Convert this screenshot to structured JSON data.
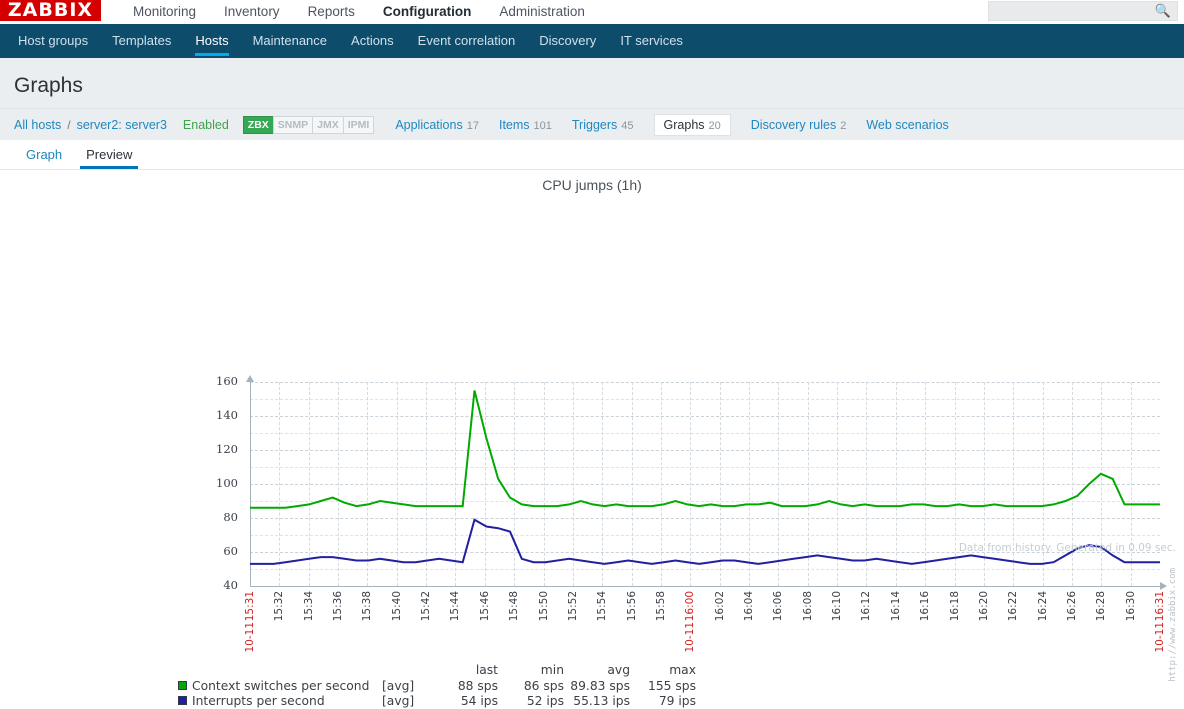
{
  "header": {
    "logo_text": "ZABBIX",
    "menu": [
      {
        "label": "Monitoring",
        "selected": false
      },
      {
        "label": "Inventory",
        "selected": false
      },
      {
        "label": "Reports",
        "selected": false
      },
      {
        "label": "Configuration",
        "selected": true
      },
      {
        "label": "Administration",
        "selected": false
      }
    ],
    "search": {
      "value": "",
      "placeholder": "",
      "icon": "search-icon"
    }
  },
  "submenu": [
    {
      "label": "Host groups",
      "selected": false
    },
    {
      "label": "Templates",
      "selected": false
    },
    {
      "label": "Hosts",
      "selected": true
    },
    {
      "label": "Maintenance",
      "selected": false
    },
    {
      "label": "Actions",
      "selected": false
    },
    {
      "label": "Event correlation",
      "selected": false
    },
    {
      "label": "Discovery",
      "selected": false
    },
    {
      "label": "IT services",
      "selected": false
    }
  ],
  "page": {
    "title": "Graphs"
  },
  "breadcrumb": {
    "all_hosts": "All hosts",
    "separator": "/",
    "host": "server2: server3",
    "status": "Enabled",
    "protocols": [
      {
        "label": "ZBX",
        "active": true
      },
      {
        "label": "SNMP",
        "active": false
      },
      {
        "label": "JMX",
        "active": false
      },
      {
        "label": "IPMI",
        "active": false
      }
    ],
    "links": [
      {
        "label": "Applications",
        "count": "17",
        "selected": false
      },
      {
        "label": "Items",
        "count": "101",
        "selected": false
      },
      {
        "label": "Triggers",
        "count": "45",
        "selected": false
      },
      {
        "label": "Graphs",
        "count": "20",
        "selected": true
      },
      {
        "label": "Discovery rules",
        "count": "2",
        "selected": false
      },
      {
        "label": "Web scenarios",
        "count": "",
        "selected": false
      }
    ]
  },
  "tabs": [
    {
      "label": "Graph",
      "selected": false
    },
    {
      "label": "Preview",
      "selected": true
    }
  ],
  "footer": {
    "note": "Data from history. Generated in 0.09 sec."
  },
  "chart_data": {
    "type": "line",
    "title": "CPU jumps (1h)",
    "xlabel": "",
    "ylabel": "",
    "ylim": [
      40,
      160
    ],
    "yticks": [
      40,
      60,
      80,
      100,
      120,
      140,
      160
    ],
    "grid": true,
    "legend_position": "bottom",
    "watermark": "http://www.zabbix.com",
    "x_start_label": "15:31",
    "x_end_label": "16:31",
    "x_date_label": "10-11",
    "x_highlight_labels": [
      "15:31",
      "16:00",
      "16:31"
    ],
    "xticks": [
      "15:31",
      "15:32",
      "15:34",
      "15:36",
      "15:38",
      "15:40",
      "15:42",
      "15:44",
      "15:46",
      "15:48",
      "15:50",
      "15:52",
      "15:54",
      "15:56",
      "15:58",
      "16:00",
      "16:02",
      "16:04",
      "16:06",
      "16:08",
      "16:10",
      "16:12",
      "16:14",
      "16:16",
      "16:18",
      "16:20",
      "16:22",
      "16:24",
      "16:26",
      "16:28",
      "16:30",
      "16:31"
    ],
    "series": [
      {
        "name": "Context switches per second",
        "func": "[avg]",
        "color": "#00aa00",
        "units": "sps",
        "last": "88 sps",
        "min": "86 sps",
        "avg": "89.83 sps",
        "max": "155 sps",
        "values": [
          86,
          86,
          86,
          86,
          87,
          88,
          90,
          92,
          89,
          87,
          88,
          90,
          89,
          88,
          87,
          87,
          87,
          87,
          87,
          155,
          127,
          103,
          92,
          88,
          87,
          87,
          87,
          88,
          90,
          88,
          87,
          88,
          87,
          87,
          87,
          88,
          90,
          88,
          87,
          88,
          87,
          87,
          88,
          88,
          89,
          87,
          87,
          87,
          88,
          90,
          88,
          87,
          88,
          87,
          87,
          87,
          88,
          88,
          87,
          87,
          88,
          87,
          87,
          88,
          87,
          87,
          87,
          87,
          88,
          90,
          93,
          100,
          106,
          103,
          88,
          88,
          88,
          88
        ]
      },
      {
        "name": "Interrupts per second",
        "func": "[avg]",
        "color": "#2020a0",
        "units": "ips",
        "last": "54 ips",
        "min": "52 ips",
        "avg": "55.13 ips",
        "max": "79 ips",
        "values": [
          53,
          53,
          53,
          54,
          55,
          56,
          57,
          57,
          56,
          55,
          55,
          56,
          55,
          54,
          54,
          55,
          56,
          55,
          54,
          79,
          75,
          74,
          72,
          56,
          54,
          54,
          55,
          56,
          55,
          54,
          53,
          54,
          55,
          54,
          53,
          54,
          55,
          54,
          53,
          54,
          55,
          55,
          54,
          53,
          54,
          55,
          56,
          57,
          58,
          57,
          56,
          55,
          55,
          56,
          55,
          54,
          53,
          54,
          55,
          56,
          57,
          58,
          57,
          56,
          55,
          54,
          53,
          53,
          54,
          58,
          62,
          64,
          63,
          58,
          54,
          54,
          54,
          54
        ]
      }
    ],
    "legend_headers": [
      "last",
      "min",
      "avg",
      "max"
    ]
  }
}
